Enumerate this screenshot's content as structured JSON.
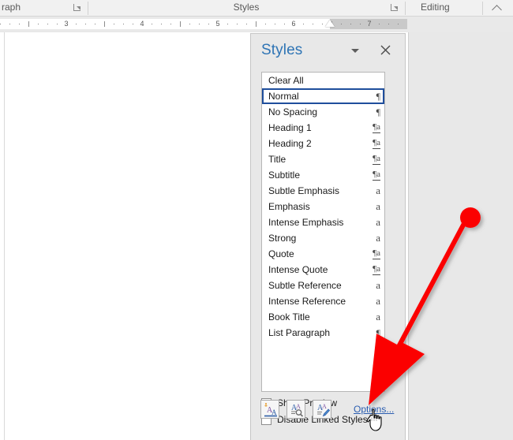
{
  "ribbon": {
    "groups": [
      {
        "label": "raph",
        "name": "paragraph-group"
      },
      {
        "label": "Styles",
        "name": "styles-group"
      },
      {
        "label": "Editing",
        "name": "editing-group"
      }
    ],
    "paragraph_label": "raph",
    "styles_label": "Styles",
    "editing_label": "Editing",
    "collapse_icon": "chevron-up-icon",
    "launcher_icon": "dialog-box-launcher-icon"
  },
  "ruler": {
    "numbers": [
      "3",
      "4",
      "5",
      "6",
      "7"
    ],
    "indent_marker": "left-indent-marker",
    "units": "inches"
  },
  "pane": {
    "title": "Styles",
    "menu_icon": "chevron-down-icon",
    "close_icon": "close-icon",
    "list": [
      {
        "label": "Clear All",
        "glyph": "",
        "type": "none",
        "selected": false
      },
      {
        "label": "Normal",
        "glyph": "¶",
        "type": "paragraph",
        "selected": true
      },
      {
        "label": "No Spacing",
        "glyph": "¶",
        "type": "paragraph",
        "selected": false
      },
      {
        "label": "Heading 1",
        "glyph": "¶a",
        "type": "linked",
        "selected": false
      },
      {
        "label": "Heading 2",
        "glyph": "¶a",
        "type": "linked",
        "selected": false
      },
      {
        "label": "Title",
        "glyph": "¶a",
        "type": "linked",
        "selected": false
      },
      {
        "label": "Subtitle",
        "glyph": "¶a",
        "type": "linked",
        "selected": false
      },
      {
        "label": "Subtle Emphasis",
        "glyph": "a",
        "type": "character",
        "selected": false
      },
      {
        "label": "Emphasis",
        "glyph": "a",
        "type": "character",
        "selected": false
      },
      {
        "label": "Intense Emphasis",
        "glyph": "a",
        "type": "character",
        "selected": false
      },
      {
        "label": "Strong",
        "glyph": "a",
        "type": "character",
        "selected": false
      },
      {
        "label": "Quote",
        "glyph": "¶a",
        "type": "linked",
        "selected": false
      },
      {
        "label": "Intense Quote",
        "glyph": "¶a",
        "type": "linked",
        "selected": false
      },
      {
        "label": "Subtle Reference",
        "glyph": "a",
        "type": "character",
        "selected": false
      },
      {
        "label": "Intense Reference",
        "glyph": "a",
        "type": "character",
        "selected": false
      },
      {
        "label": "Book Title",
        "glyph": "a",
        "type": "character",
        "selected": false
      },
      {
        "label": "List Paragraph",
        "glyph": "¶",
        "type": "paragraph",
        "selected": false
      }
    ],
    "checkboxes": [
      {
        "label": "Show Preview",
        "checked": false,
        "name": "show-preview-checkbox"
      },
      {
        "label": "Disable Linked Styles",
        "checked": false,
        "name": "disable-linked-styles-checkbox"
      }
    ],
    "show_preview_label": "Show Preview",
    "disable_linked_label": "Disable Linked Styles",
    "buttons": [
      {
        "name": "new-style-button",
        "icon": "new-style-icon"
      },
      {
        "name": "style-inspector-button",
        "icon": "style-inspector-icon"
      },
      {
        "name": "manage-styles-button",
        "icon": "manage-styles-icon"
      }
    ],
    "options_label": "Options...",
    "accent_color": "#2e74b5",
    "link_color": "#2a5db0",
    "selection_border": "#1f4e9c"
  },
  "annotation": {
    "arrow_color": "#ff0000",
    "arrow_name": "red-callout-arrow",
    "points_to": "Options..."
  },
  "cursor": {
    "name": "hand-pointer-cursor"
  }
}
